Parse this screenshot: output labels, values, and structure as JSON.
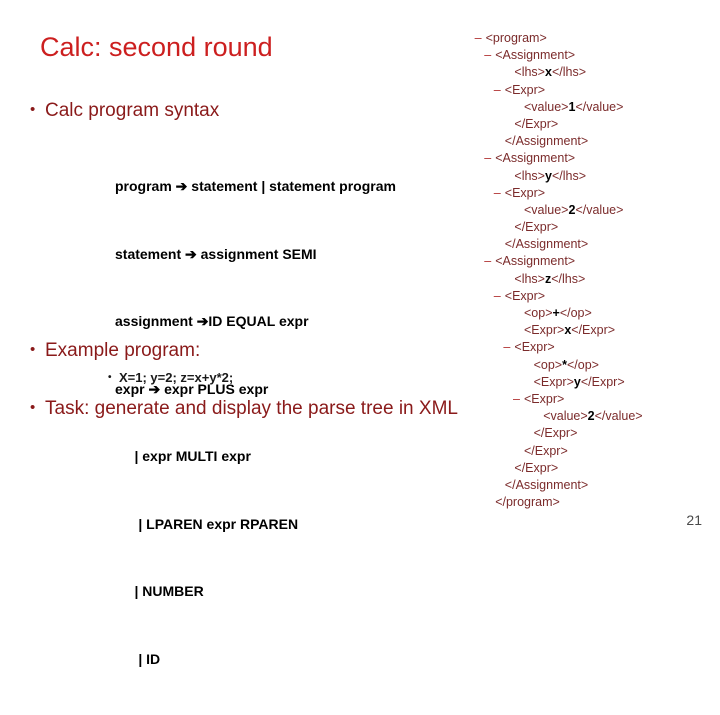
{
  "slide": {
    "title": "Calc: second round",
    "page_number": "21",
    "title_color": "#CC1F1F",
    "bullet_color": "#8A1A1A",
    "body_color": "#000000",
    "xml_color": "#7B2B2B",
    "xml_value_color": "#000000",
    "background": "#ffffff"
  },
  "left": {
    "bullets": [
      {
        "marker": "•",
        "text": "Calc program syntax"
      },
      {
        "marker": "•",
        "text": "Example program:"
      },
      {
        "marker": "•",
        "text": "Task: generate and display the parse tree in XML"
      }
    ],
    "grammar": {
      "label": "Calc program syntax",
      "lines": [
        "program ➔ statement | statement program",
        "statement ➔ assignment SEMI",
        "assignment ➔ID EQUAL expr",
        "expr ➔ expr PLUS expr",
        "     | expr MULTI expr",
        "      | LPAREN expr RPAREN",
        "     | NUMBER",
        "      | ID"
      ]
    },
    "example_program": {
      "marker": "•",
      "text": "X=1; y=2; z=x+y*2;"
    }
  },
  "xml_tree": {
    "lines": [
      {
        "indent": 1,
        "minus": true,
        "text": "<program>"
      },
      {
        "indent": 2,
        "minus": true,
        "text": "<Assignment>"
      },
      {
        "indent": 4,
        "minus": false,
        "text": "<lhs>",
        "value": "x",
        "text_after": "</lhs>"
      },
      {
        "indent": 3,
        "minus": true,
        "text": "<Expr>"
      },
      {
        "indent": 5,
        "minus": false,
        "text": "<value>",
        "value": "1",
        "text_after": "</value>"
      },
      {
        "indent": 4,
        "minus": false,
        "text": "</Expr>"
      },
      {
        "indent": 3,
        "minus": false,
        "text": "</Assignment>"
      },
      {
        "indent": 2,
        "minus": true,
        "text": "<Assignment>"
      },
      {
        "indent": 4,
        "minus": false,
        "text": "<lhs>",
        "value": "y",
        "text_after": "</lhs>"
      },
      {
        "indent": 3,
        "minus": true,
        "text": "<Expr>"
      },
      {
        "indent": 5,
        "minus": false,
        "text": "<value>",
        "value": "2",
        "text_after": "</value>"
      },
      {
        "indent": 4,
        "minus": false,
        "text": "</Expr>"
      },
      {
        "indent": 3,
        "minus": false,
        "text": "</Assignment>"
      },
      {
        "indent": 2,
        "minus": true,
        "text": "<Assignment>"
      },
      {
        "indent": 4,
        "minus": false,
        "text": "<lhs>",
        "value": "z",
        "text_after": "</lhs>"
      },
      {
        "indent": 3,
        "minus": true,
        "text": "<Expr>"
      },
      {
        "indent": 5,
        "minus": false,
        "text": "<op>",
        "value": "+",
        "text_after": "</op>"
      },
      {
        "indent": 5,
        "minus": false,
        "text": "<Expr>",
        "value": "x",
        "text_after": "</Expr>"
      },
      {
        "indent": 4,
        "minus": true,
        "text": "<Expr>"
      },
      {
        "indent": 6,
        "minus": false,
        "text": "<op>",
        "value": "*",
        "text_after": "</op>"
      },
      {
        "indent": 6,
        "minus": false,
        "text": "<Expr>",
        "value": "y",
        "text_after": "</Expr>"
      },
      {
        "indent": 5,
        "minus": true,
        "text": "<Expr>"
      },
      {
        "indent": 7,
        "minus": false,
        "text": "<value>",
        "value": "2",
        "text_after": "</value>"
      },
      {
        "indent": 6,
        "minus": false,
        "text": "</Expr>"
      },
      {
        "indent": 5,
        "minus": false,
        "text": "</Expr>"
      },
      {
        "indent": 4,
        "minus": false,
        "text": "</Expr>"
      },
      {
        "indent": 3,
        "minus": false,
        "text": "</Assignment>"
      },
      {
        "indent": 2,
        "minus": false,
        "text": "</program>"
      }
    ]
  }
}
